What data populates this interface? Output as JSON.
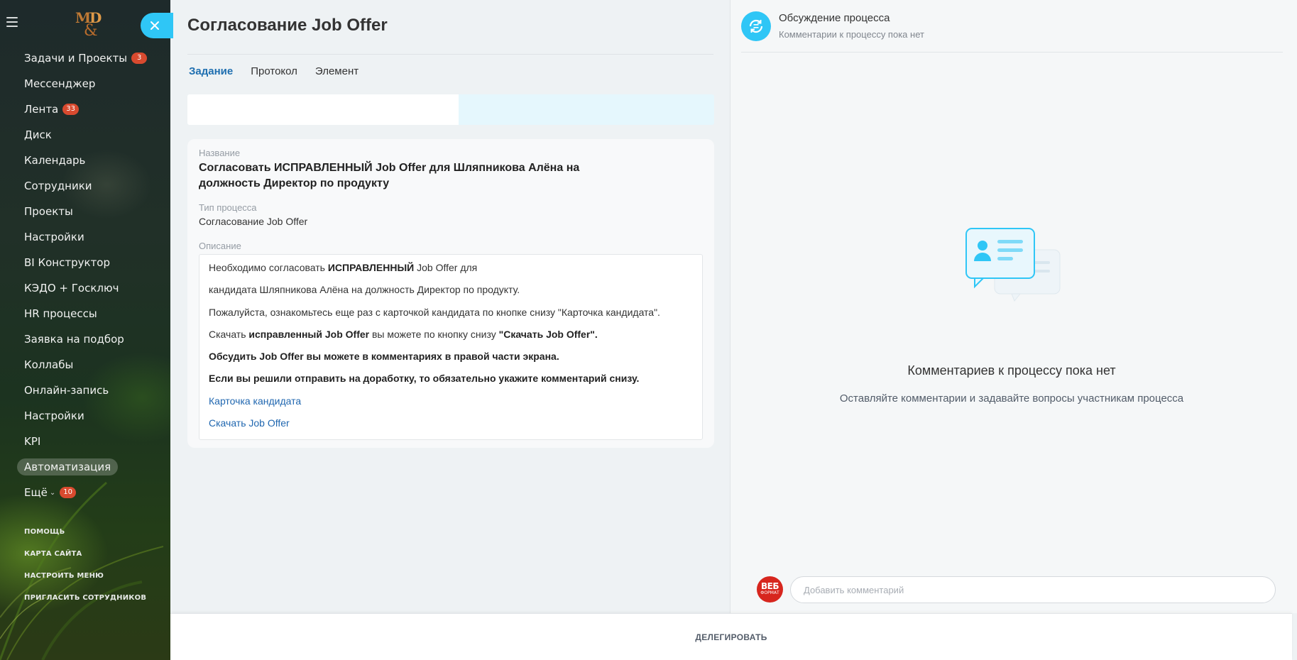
{
  "app": {
    "logo_text": "M&D",
    "close_label": "×"
  },
  "sidebar": {
    "items": [
      {
        "label": "Задачи и Проекты",
        "badge": "3"
      },
      {
        "label": "Мессенджер"
      },
      {
        "label": "Лента",
        "badge": "33"
      },
      {
        "label": "Диск"
      },
      {
        "label": "Календарь"
      },
      {
        "label": "Сотрудники"
      },
      {
        "label": "Проекты"
      },
      {
        "label": "Настройки"
      },
      {
        "label": "BI Конструктор"
      },
      {
        "label": "КЭДО + Госключ"
      },
      {
        "label": "HR процессы"
      },
      {
        "label": "Заявка на подбор"
      },
      {
        "label": "Коллабы"
      },
      {
        "label": "Онлайн-запись"
      },
      {
        "label": "Настройки"
      },
      {
        "label": "KPI"
      },
      {
        "label": "Автоматизация",
        "active": true
      },
      {
        "label": "Ещё",
        "badge": "10",
        "chevron": "⌄"
      }
    ],
    "footer": {
      "help": "ПОМОЩЬ",
      "sitemap": "КАРТА САЙТА",
      "configure_menu": "НАСТРОИТЬ МЕНЮ",
      "invite": "ПРИГЛАСИТЬ СОТРУДНИКОВ"
    }
  },
  "task": {
    "title": "Согласование Job Offer",
    "tabs": [
      {
        "label": "Задание",
        "active": true
      },
      {
        "label": "Протокол"
      },
      {
        "label": "Элемент"
      }
    ],
    "fields": {
      "name_label": "Название",
      "name_value": "Согласовать ИСПРАВЛЕННЫЙ Job Offer для Шляпникова Алёна на должность Директор по продукту",
      "type_label": "Тип процесса",
      "type_value": "Согласование Job Offer",
      "description_label": "Описание"
    },
    "description": {
      "line1_a": "Необходимо согласовать ",
      "line1_b": "ИСПРАВЛЕННЫЙ",
      "line1_c": " Job Offer для",
      "line2": "кандидата Шляпникова Алёна на должность Директор по продукту.",
      "line3": "Пожалуйста, ознакомьтесь еще раз с карточкой кандидата по кнопке снизу \"Карточка кандидата\".",
      "line4_a": "Скачать ",
      "line4_b": "исправленный Job Offer",
      "line4_c": " вы можете по кнопку снизу ",
      "line4_d": "\"Скачать Job Offer\".",
      "line5": "Обсудить Job Offer вы можете в комментариях в правой части экрана.",
      "line6": "Если вы решили отправить на доработку, то обязательно укажите комментарий снизу.",
      "link1": "Карточка кандидата",
      "link2": "Скачать Job Offer"
    }
  },
  "discussion": {
    "title": "Обсуждение процесса",
    "subtitle": "Комментарии к процессу пока нет",
    "empty_title": "Комментариев к процессу пока нет",
    "empty_subtitle": "Оставляйте комментарии и задавайте вопросы участникам процесса",
    "avatar_line1": "ВЕБ",
    "avatar_line2": "ФОРМАТ",
    "comment_placeholder": "Добавить комментарий"
  },
  "bottom": {
    "delegate_label": "ДЕЛЕГИРОВАТЬ"
  },
  "colors": {
    "accent": "#2fc6f6",
    "link": "#2067b0",
    "badge": "#d84a2f",
    "avatar": "#d7261e"
  }
}
